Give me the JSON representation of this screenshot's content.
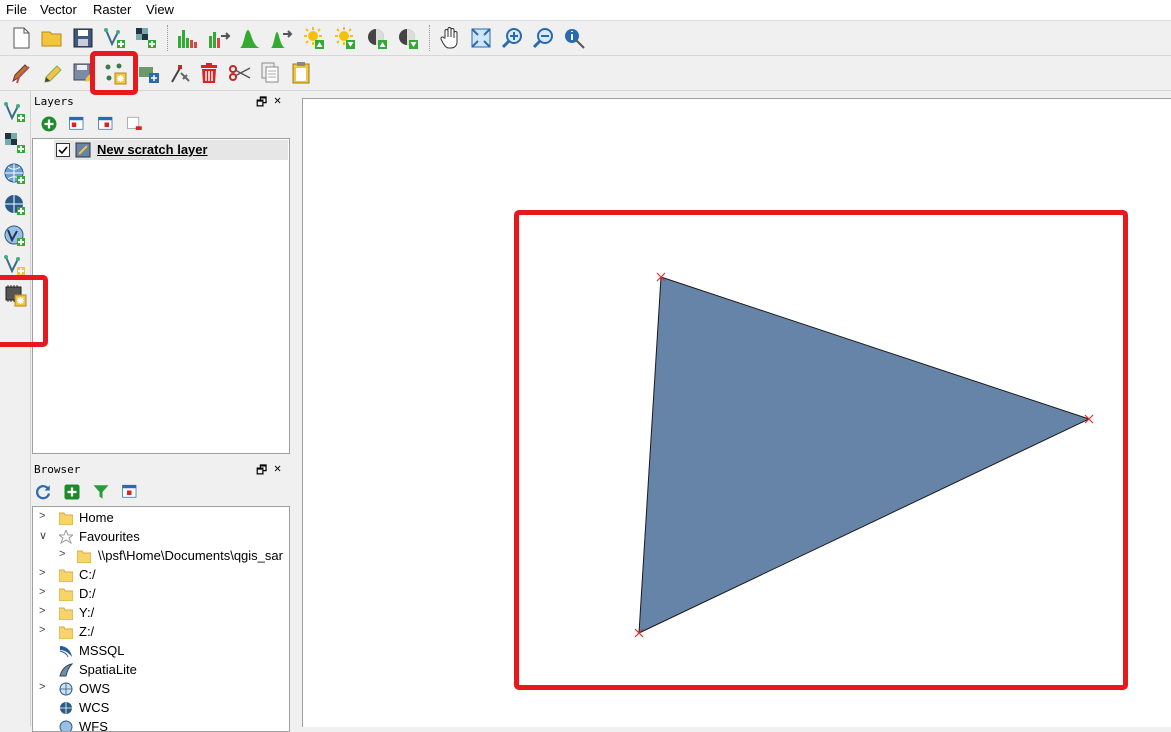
{
  "menu": {
    "items": [
      "File",
      "Vector",
      "Raster",
      "View"
    ]
  },
  "layers_panel": {
    "title": "Layers",
    "layers": [
      {
        "name": "New scratch layer",
        "checked": true
      }
    ]
  },
  "browser_panel": {
    "title": "Browser",
    "items": [
      {
        "label": "Home",
        "icon": "folder-icon",
        "expand": "right"
      },
      {
        "label": "Favourites",
        "icon": "star-icon",
        "expand": "down"
      },
      {
        "label": "\\\\psf\\Home\\Documents\\qgis_sar",
        "icon": "folder-icon",
        "expand": "right"
      },
      {
        "label": "C:/",
        "icon": "folder-icon",
        "expand": "right"
      },
      {
        "label": "D:/",
        "icon": "folder-icon",
        "expand": "right"
      },
      {
        "label": "Y:/",
        "icon": "folder-icon",
        "expand": "right"
      },
      {
        "label": "Z:/",
        "icon": "folder-icon",
        "expand": "right"
      },
      {
        "label": "MSSQL",
        "icon": "mssql-icon",
        "expand": ""
      },
      {
        "label": "SpatiaLite",
        "icon": "spatialite-icon",
        "expand": ""
      },
      {
        "label": "OWS",
        "icon": "ows-icon",
        "expand": "right"
      },
      {
        "label": "WCS",
        "icon": "wcs-icon",
        "expand": ""
      },
      {
        "label": "WFS",
        "icon": "wfs-icon",
        "expand": ""
      }
    ]
  },
  "panel_controls": {
    "float": "🗗",
    "close": "✕"
  },
  "colors": {
    "polygon_fill": "#6683a8",
    "highlight": "#e8181c",
    "vertex": "#e03030"
  }
}
